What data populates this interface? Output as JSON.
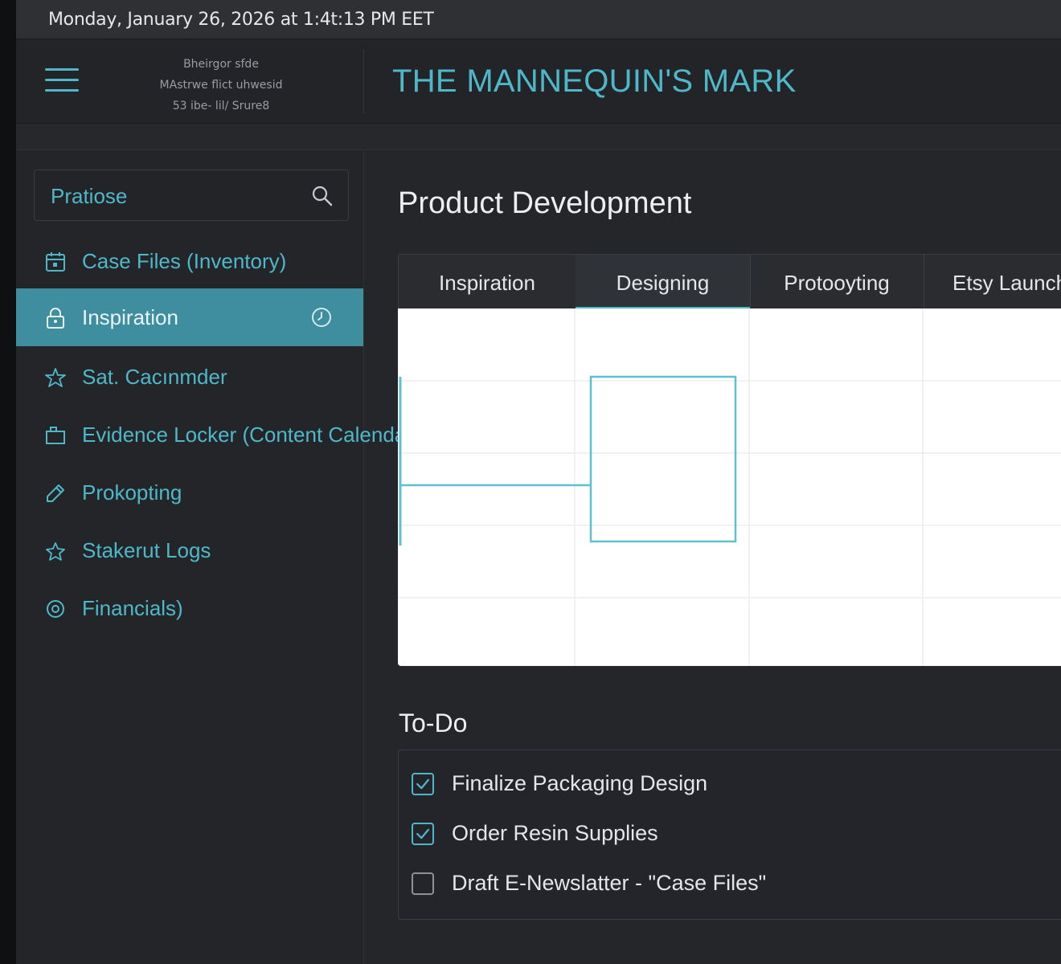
{
  "statusbar": {
    "datetime": "Monday, January 26, 2026 at 1:4t:13 PM EET"
  },
  "header": {
    "brand_lines": [
      "Bheirgor sfde",
      "MAstrwe flict uhwesid",
      "53 ibe- lil/ Srure8"
    ],
    "title": "THE MANNEQUIN'S MARK"
  },
  "sidebar": {
    "search": {
      "value": "Pratiose",
      "placeholder": ""
    },
    "items": [
      {
        "label": "Case Files (Inventory)",
        "icon": "calendar-icon",
        "active": false
      },
      {
        "label": "Inspiration",
        "icon": "lock-icon",
        "active": true,
        "badge": "clock-icon"
      },
      {
        "label": "Sat. Cacınmder",
        "icon": "star-icon",
        "active": false
      },
      {
        "label": "Evidence Locker (Content Calendar)",
        "icon": "folder-icon",
        "active": false
      },
      {
        "label": "Prokopting",
        "icon": "edit-icon",
        "active": false
      },
      {
        "label": "Stakerut Logs",
        "icon": "star-outline-icon",
        "active": false
      },
      {
        "label": "Financials)",
        "icon": "coin-icon",
        "active": false
      }
    ]
  },
  "main": {
    "title": "Product Development",
    "tabs": [
      {
        "label": "Inspiration",
        "active": false
      },
      {
        "label": "Designing",
        "active": true
      },
      {
        "label": "Protooyting",
        "active": false
      },
      {
        "label": "Etsy Launch",
        "active": false
      }
    ]
  },
  "todo": {
    "title": "To-Do",
    "items": [
      {
        "label": "Finalize Packaging Design",
        "checked": true
      },
      {
        "label": "Order Resin Supplies",
        "checked": true
      },
      {
        "label": "Draft E-Newslatter - \"Case Files\"",
        "checked": false
      }
    ]
  },
  "colors": {
    "accent": "#4fb8c8",
    "active_nav": "#3f8ea0",
    "background": "#24262a"
  }
}
